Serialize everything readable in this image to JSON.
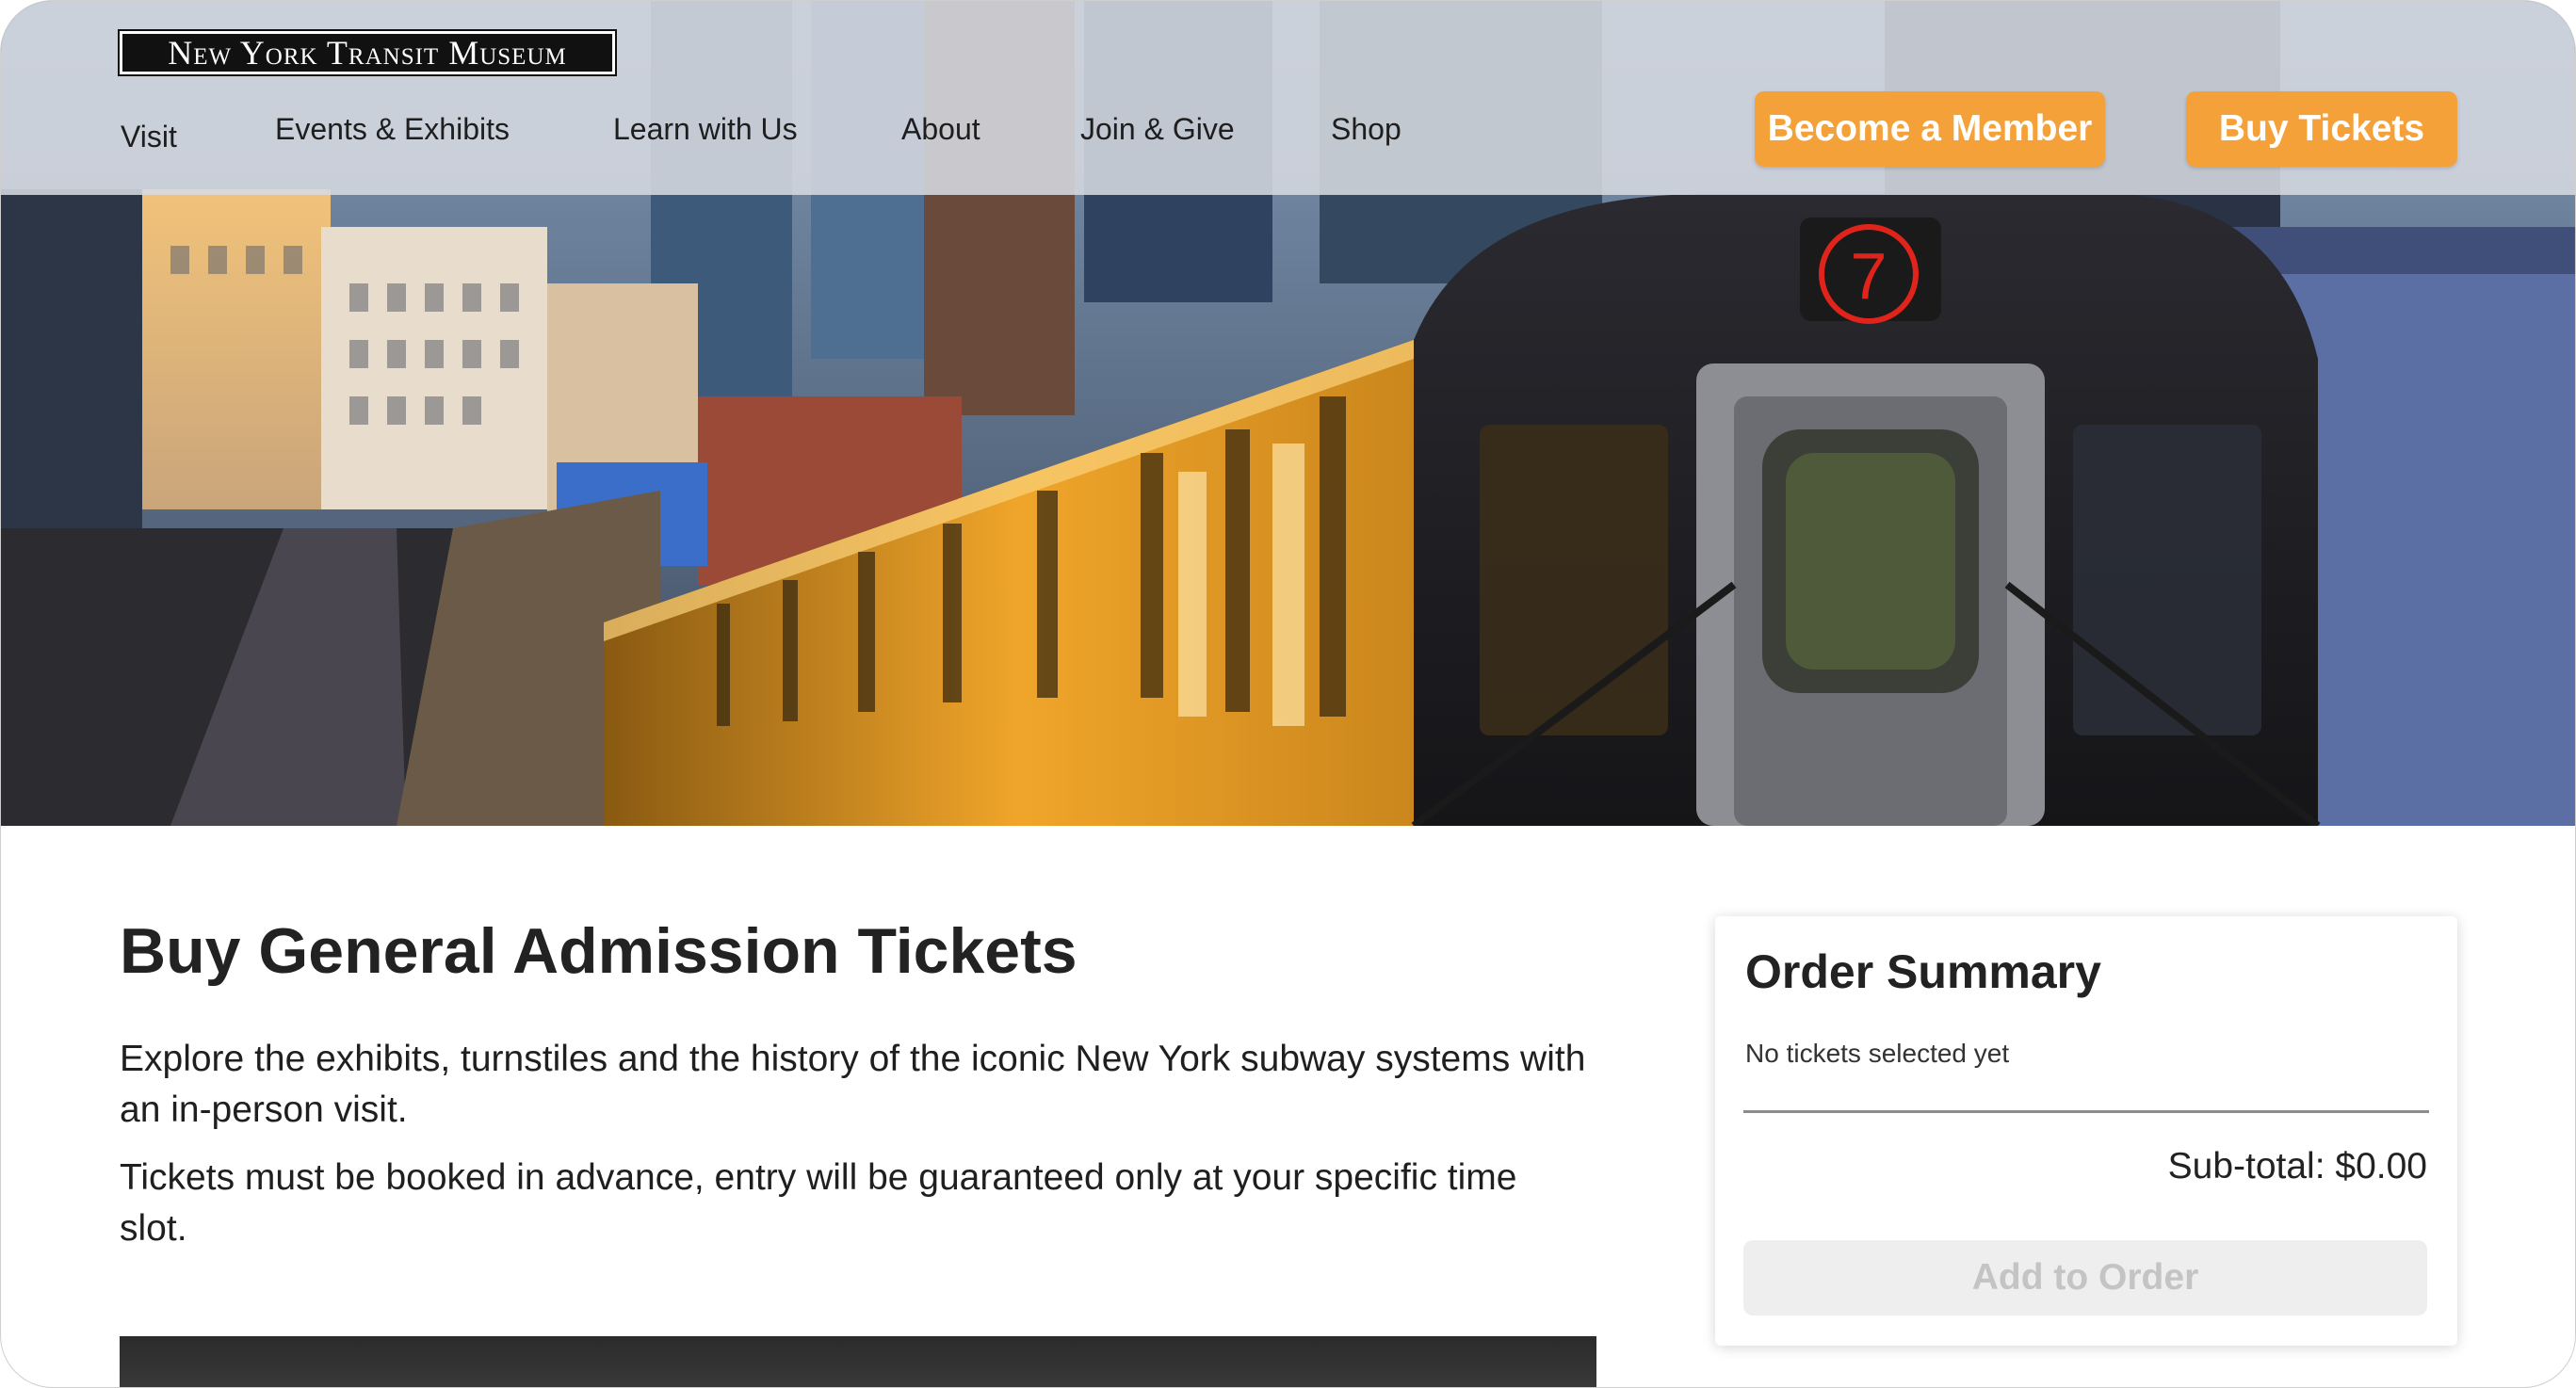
{
  "brand": {
    "logo_text": "New York Transit Museum"
  },
  "nav": {
    "items": [
      {
        "label": "Visit"
      },
      {
        "label": "Events & Exhibits"
      },
      {
        "label": "Learn with Us"
      },
      {
        "label": "About"
      },
      {
        "label": "Join & Give"
      },
      {
        "label": "Shop"
      }
    ],
    "member_button": "Become a Member",
    "tickets_button": "Buy Tickets"
  },
  "hero": {
    "train_line": "7"
  },
  "main": {
    "title": "Buy General Admission Tickets",
    "intro": "Explore the exhibits, turnstiles and the history of the iconic New York subway systems with an in-person visit.",
    "notice": "Tickets must be booked in advance, entry will be guaranteed only at your specific time slot."
  },
  "order_summary": {
    "title": "Order Summary",
    "empty_text": "No tickets selected yet",
    "subtotal": "Sub-total: $0.00",
    "add_button": "Add to Order"
  },
  "colors": {
    "accent_orange": "#f5a13a",
    "disabled_button": "#eeeeee",
    "line_badge_red": "#e0241b"
  }
}
